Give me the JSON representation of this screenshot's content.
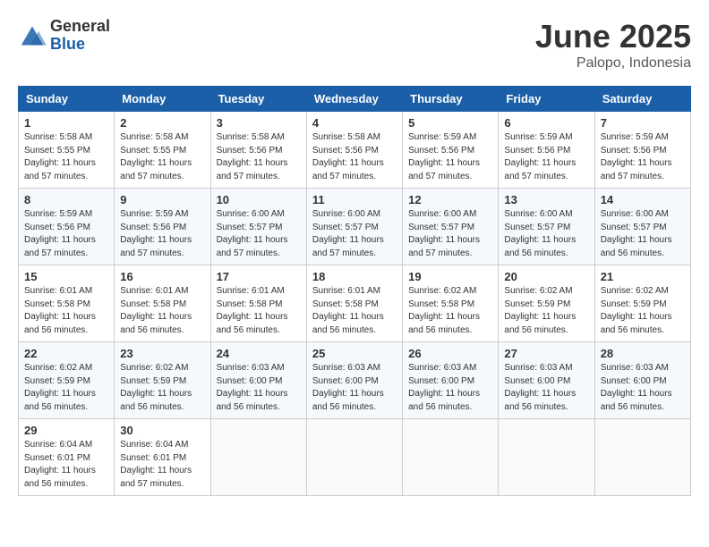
{
  "logo": {
    "general": "General",
    "blue": "Blue"
  },
  "title": "June 2025",
  "location": "Palopo, Indonesia",
  "weekdays": [
    "Sunday",
    "Monday",
    "Tuesday",
    "Wednesday",
    "Thursday",
    "Friday",
    "Saturday"
  ],
  "weeks": [
    [
      {
        "day": "1",
        "sunrise": "5:58 AM",
        "sunset": "5:55 PM",
        "daylight": "11 hours and 57 minutes."
      },
      {
        "day": "2",
        "sunrise": "5:58 AM",
        "sunset": "5:55 PM",
        "daylight": "11 hours and 57 minutes."
      },
      {
        "day": "3",
        "sunrise": "5:58 AM",
        "sunset": "5:56 PM",
        "daylight": "11 hours and 57 minutes."
      },
      {
        "day": "4",
        "sunrise": "5:58 AM",
        "sunset": "5:56 PM",
        "daylight": "11 hours and 57 minutes."
      },
      {
        "day": "5",
        "sunrise": "5:59 AM",
        "sunset": "5:56 PM",
        "daylight": "11 hours and 57 minutes."
      },
      {
        "day": "6",
        "sunrise": "5:59 AM",
        "sunset": "5:56 PM",
        "daylight": "11 hours and 57 minutes."
      },
      {
        "day": "7",
        "sunrise": "5:59 AM",
        "sunset": "5:56 PM",
        "daylight": "11 hours and 57 minutes."
      }
    ],
    [
      {
        "day": "8",
        "sunrise": "5:59 AM",
        "sunset": "5:56 PM",
        "daylight": "11 hours and 57 minutes."
      },
      {
        "day": "9",
        "sunrise": "5:59 AM",
        "sunset": "5:56 PM",
        "daylight": "11 hours and 57 minutes."
      },
      {
        "day": "10",
        "sunrise": "6:00 AM",
        "sunset": "5:57 PM",
        "daylight": "11 hours and 57 minutes."
      },
      {
        "day": "11",
        "sunrise": "6:00 AM",
        "sunset": "5:57 PM",
        "daylight": "11 hours and 57 minutes."
      },
      {
        "day": "12",
        "sunrise": "6:00 AM",
        "sunset": "5:57 PM",
        "daylight": "11 hours and 57 minutes."
      },
      {
        "day": "13",
        "sunrise": "6:00 AM",
        "sunset": "5:57 PM",
        "daylight": "11 hours and 56 minutes."
      },
      {
        "day": "14",
        "sunrise": "6:00 AM",
        "sunset": "5:57 PM",
        "daylight": "11 hours and 56 minutes."
      }
    ],
    [
      {
        "day": "15",
        "sunrise": "6:01 AM",
        "sunset": "5:58 PM",
        "daylight": "11 hours and 56 minutes."
      },
      {
        "day": "16",
        "sunrise": "6:01 AM",
        "sunset": "5:58 PM",
        "daylight": "11 hours and 56 minutes."
      },
      {
        "day": "17",
        "sunrise": "6:01 AM",
        "sunset": "5:58 PM",
        "daylight": "11 hours and 56 minutes."
      },
      {
        "day": "18",
        "sunrise": "6:01 AM",
        "sunset": "5:58 PM",
        "daylight": "11 hours and 56 minutes."
      },
      {
        "day": "19",
        "sunrise": "6:02 AM",
        "sunset": "5:58 PM",
        "daylight": "11 hours and 56 minutes."
      },
      {
        "day": "20",
        "sunrise": "6:02 AM",
        "sunset": "5:59 PM",
        "daylight": "11 hours and 56 minutes."
      },
      {
        "day": "21",
        "sunrise": "6:02 AM",
        "sunset": "5:59 PM",
        "daylight": "11 hours and 56 minutes."
      }
    ],
    [
      {
        "day": "22",
        "sunrise": "6:02 AM",
        "sunset": "5:59 PM",
        "daylight": "11 hours and 56 minutes."
      },
      {
        "day": "23",
        "sunrise": "6:02 AM",
        "sunset": "5:59 PM",
        "daylight": "11 hours and 56 minutes."
      },
      {
        "day": "24",
        "sunrise": "6:03 AM",
        "sunset": "6:00 PM",
        "daylight": "11 hours and 56 minutes."
      },
      {
        "day": "25",
        "sunrise": "6:03 AM",
        "sunset": "6:00 PM",
        "daylight": "11 hours and 56 minutes."
      },
      {
        "day": "26",
        "sunrise": "6:03 AM",
        "sunset": "6:00 PM",
        "daylight": "11 hours and 56 minutes."
      },
      {
        "day": "27",
        "sunrise": "6:03 AM",
        "sunset": "6:00 PM",
        "daylight": "11 hours and 56 minutes."
      },
      {
        "day": "28",
        "sunrise": "6:03 AM",
        "sunset": "6:00 PM",
        "daylight": "11 hours and 56 minutes."
      }
    ],
    [
      {
        "day": "29",
        "sunrise": "6:04 AM",
        "sunset": "6:01 PM",
        "daylight": "11 hours and 56 minutes."
      },
      {
        "day": "30",
        "sunrise": "6:04 AM",
        "sunset": "6:01 PM",
        "daylight": "11 hours and 57 minutes."
      },
      null,
      null,
      null,
      null,
      null
    ]
  ]
}
